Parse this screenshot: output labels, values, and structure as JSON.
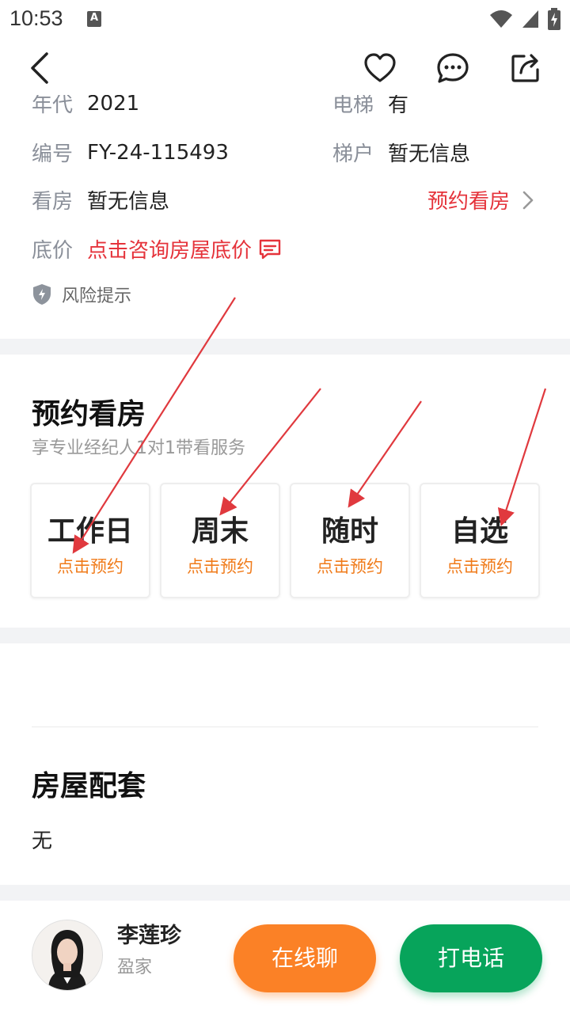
{
  "status_bar": {
    "time": "10:53",
    "notification_icon": "A"
  },
  "info": {
    "partial_row": {
      "left_label": "年代",
      "left_value": "2021",
      "right_label": "电梯",
      "right_value": "有"
    },
    "rows": [
      {
        "label": "编号",
        "value": "FY-24-115493",
        "right_label": "梯户",
        "right_value": "暂无信息"
      },
      {
        "label": "看房",
        "value": "暂无信息",
        "right_link": "预约看房"
      },
      {
        "label": "底价",
        "value": "点击咨询房屋底价"
      }
    ],
    "risk_label": "风险提示"
  },
  "booking": {
    "title": "预约看房",
    "subtitle": "享专业经纪人1对1带看服务",
    "slots": [
      {
        "title": "工作日",
        "action": "点击预约"
      },
      {
        "title": "周末",
        "action": "点击预约"
      },
      {
        "title": "随时",
        "action": "点击预约"
      },
      {
        "title": "自选",
        "action": "点击预约"
      }
    ]
  },
  "facilities": {
    "title": "房屋配套",
    "value": "无"
  },
  "agent": {
    "name": "李莲珍",
    "company": "盈家"
  },
  "actions": {
    "chat": "在线聊",
    "call": "打电话"
  },
  "colors": {
    "accent_red": "#e5333b",
    "orange": "#fb8126",
    "green": "#07a45b",
    "annotation_arrow": "#e0393e"
  },
  "icons": [
    "back-icon",
    "heart-icon",
    "message-icon",
    "share-icon",
    "chevron-right-icon",
    "chat-bubble-icon",
    "shield-icon",
    "wifi-icon",
    "signal-icon",
    "battery-icon"
  ]
}
